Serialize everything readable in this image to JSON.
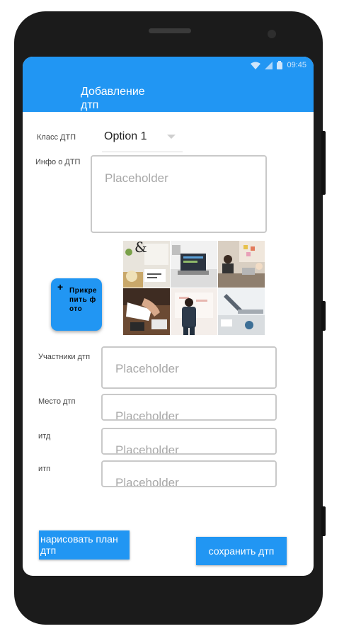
{
  "status_bar": {
    "time": "09:45"
  },
  "app_bar": {
    "title": "Добавление дтп"
  },
  "form": {
    "class_label": "Класс ДТП",
    "class_value": "Option 1",
    "info_label": "Инфо о ДТП",
    "info_placeholder": "Placeholder",
    "attach_button_label": "Прикрепить фото",
    "participants_label": "Участники дтп",
    "participants_placeholder": "Placeholder",
    "place_label": "Место дтп",
    "place_placeholder": "Placeholder",
    "etc1_label": "итд",
    "etc1_placeholder": "Placeholder",
    "etc2_label": "итп",
    "etc2_placeholder": "Placeholder"
  },
  "photos": [
    {
      "name": "photo-desk-ampersand",
      "icon": "photo"
    },
    {
      "name": "photo-laptop-screen",
      "icon": "photo"
    },
    {
      "name": "photo-office-meeting",
      "icon": "photo"
    },
    {
      "name": "photo-writing-hands",
      "icon": "photo"
    },
    {
      "name": "photo-whiteboard-man",
      "icon": "photo"
    },
    {
      "name": "photo-laptop-desk",
      "icon": "photo"
    }
  ],
  "actions": {
    "draw_plan_label": "нарисовать план дтп",
    "save_label": "сохранить дтп"
  },
  "colors": {
    "accent": "#2196f3",
    "frame": "#1b1b1b"
  }
}
